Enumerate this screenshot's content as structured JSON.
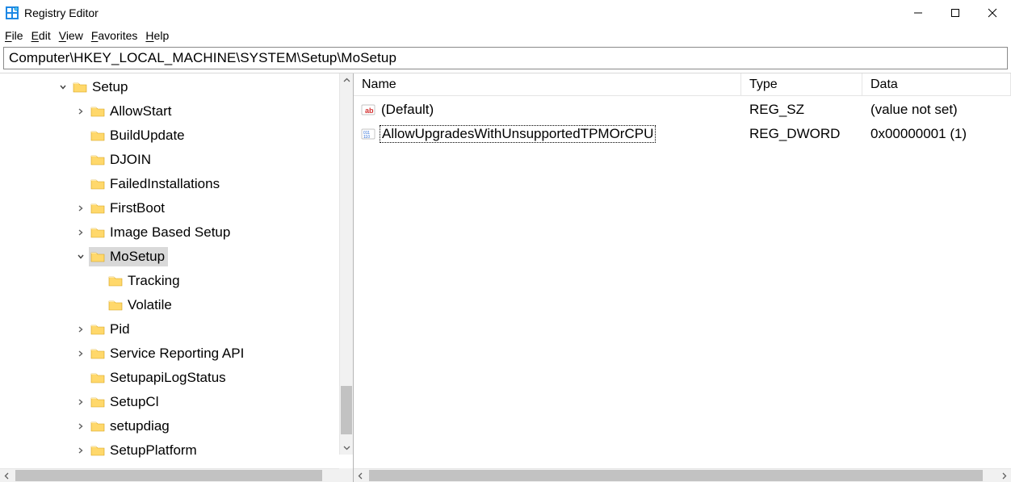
{
  "titlebar": {
    "title": "Registry Editor"
  },
  "menubar": {
    "file": "File",
    "edit": "Edit",
    "view": "View",
    "favorites": "Favorites",
    "help": "Help"
  },
  "addressbar": {
    "path": "Computer\\HKEY_LOCAL_MACHINE\\SYSTEM\\Setup\\MoSetup"
  },
  "tree": {
    "items": [
      {
        "label": "Setup",
        "level": 0,
        "expander": "open",
        "selected": false
      },
      {
        "label": "AllowStart",
        "level": 1,
        "expander": "closed",
        "selected": false
      },
      {
        "label": "BuildUpdate",
        "level": 1,
        "expander": "none",
        "selected": false
      },
      {
        "label": "DJOIN",
        "level": 1,
        "expander": "none",
        "selected": false
      },
      {
        "label": "FailedInstallations",
        "level": 1,
        "expander": "none",
        "selected": false
      },
      {
        "label": "FirstBoot",
        "level": 1,
        "expander": "closed",
        "selected": false
      },
      {
        "label": "Image Based Setup",
        "level": 1,
        "expander": "closed",
        "selected": false
      },
      {
        "label": "MoSetup",
        "level": 1,
        "expander": "open",
        "selected": true
      },
      {
        "label": "Tracking",
        "level": 2,
        "expander": "none",
        "selected": false
      },
      {
        "label": "Volatile",
        "level": 2,
        "expander": "none",
        "selected": false
      },
      {
        "label": "Pid",
        "level": 1,
        "expander": "closed",
        "selected": false
      },
      {
        "label": "Service Reporting API",
        "level": 1,
        "expander": "closed",
        "selected": false
      },
      {
        "label": "SetupapiLogStatus",
        "level": 1,
        "expander": "none",
        "selected": false
      },
      {
        "label": "SetupCl",
        "level": 1,
        "expander": "closed",
        "selected": false
      },
      {
        "label": "setupdiag",
        "level": 1,
        "expander": "closed",
        "selected": false
      },
      {
        "label": "SetupPlatform",
        "level": 1,
        "expander": "closed",
        "selected": false
      }
    ]
  },
  "list": {
    "headers": {
      "name": "Name",
      "type": "Type",
      "data": "Data"
    },
    "rows": [
      {
        "icon": "string",
        "name": "(Default)",
        "type": "REG_SZ",
        "data": "(value not set)",
        "focused": false
      },
      {
        "icon": "binary",
        "name": "AllowUpgradesWithUnsupportedTPMOrCPU",
        "type": "REG_DWORD",
        "data": "0x00000001 (1)",
        "focused": true
      }
    ]
  }
}
